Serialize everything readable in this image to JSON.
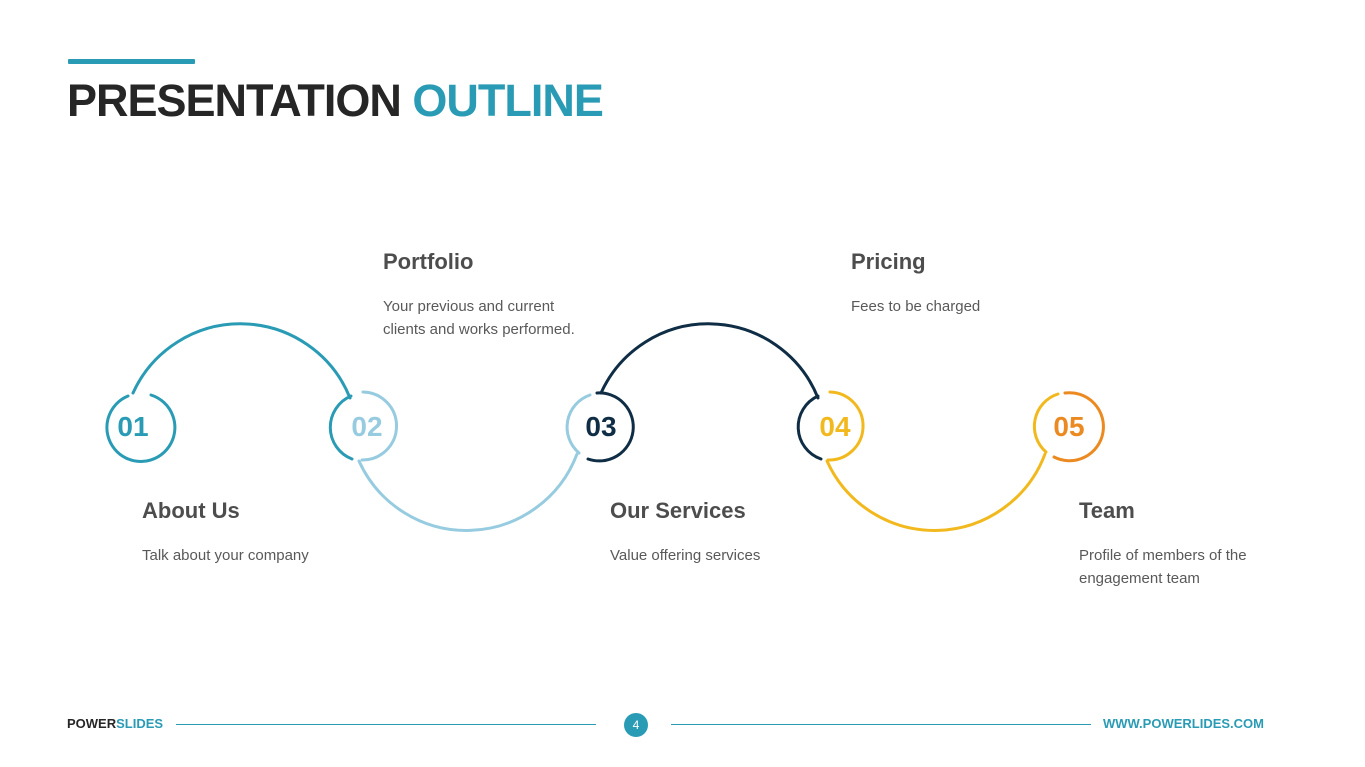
{
  "title": {
    "main": "PRESENTATION",
    "accent": "OUTLINE"
  },
  "colors": {
    "teal": "#2a9bb5",
    "light_blue": "#96cbe0",
    "navy": "#0f2d45",
    "yellow": "#f2b91e",
    "orange": "#ec8a22"
  },
  "steps": [
    {
      "number": "01",
      "title": "About Us",
      "description": "Talk about your company"
    },
    {
      "number": "02",
      "title": "Portfolio",
      "description": "Your previous and current clients and works performed."
    },
    {
      "number": "03",
      "title": "Our Services",
      "description": "Value offering services"
    },
    {
      "number": "04",
      "title": "Pricing",
      "description": "Fees to be charged"
    },
    {
      "number": "05",
      "title": "Team",
      "description": "Profile of members of the engagement team"
    }
  ],
  "footer": {
    "brand_main": "POWER",
    "brand_accent": "SLIDES",
    "page": "4",
    "url": "WWW.POWERLIDES.COM"
  }
}
